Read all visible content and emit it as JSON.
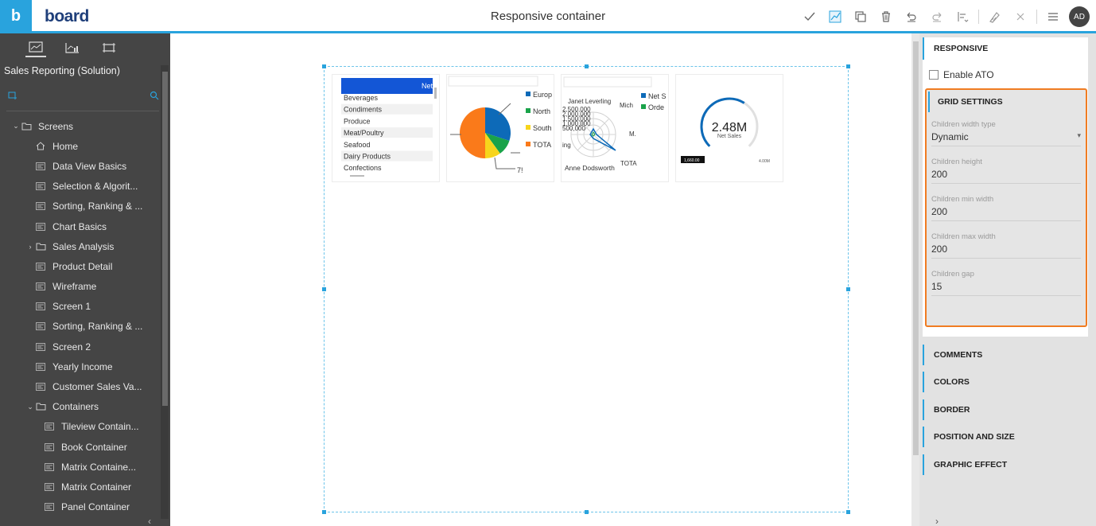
{
  "app": {
    "logo_letter": "b",
    "logo_word": "board"
  },
  "header": {
    "title": "Responsive container",
    "avatar_initials": "AD"
  },
  "colors": {
    "accent": "#29a3dd",
    "highlight": "#f07c22",
    "sidebar_bg": "#454545"
  },
  "sidebar": {
    "title": "Sales Reporting (Solution)",
    "items": [
      {
        "label": "Screens",
        "type": "folder",
        "chevron": "⌄",
        "indent": 0
      },
      {
        "label": "Home",
        "type": "home",
        "chevron": "",
        "indent": 1
      },
      {
        "label": "Data View Basics",
        "type": "screen",
        "chevron": "",
        "indent": 1
      },
      {
        "label": "Selection & Algorit...",
        "type": "screen",
        "chevron": "",
        "indent": 1
      },
      {
        "label": "Sorting, Ranking & ...",
        "type": "screen",
        "chevron": "",
        "indent": 1
      },
      {
        "label": "Chart Basics",
        "type": "screen",
        "chevron": "",
        "indent": 1
      },
      {
        "label": "Sales Analysis",
        "type": "folder",
        "chevron": "›",
        "indent": 1
      },
      {
        "label": "Product Detail",
        "type": "screen",
        "chevron": "",
        "indent": 1
      },
      {
        "label": "Wireframe",
        "type": "screen",
        "chevron": "",
        "indent": 1
      },
      {
        "label": "Screen 1",
        "type": "screen",
        "chevron": "",
        "indent": 1
      },
      {
        "label": "Sorting, Ranking & ...",
        "type": "screen",
        "chevron": "",
        "indent": 1
      },
      {
        "label": "Screen 2",
        "type": "screen",
        "chevron": "",
        "indent": 1
      },
      {
        "label": "Yearly Income",
        "type": "screen",
        "chevron": "",
        "indent": 1
      },
      {
        "label": "Customer Sales Va...",
        "type": "screen",
        "chevron": "",
        "indent": 1
      },
      {
        "label": "Containers",
        "type": "folder",
        "chevron": "⌄",
        "indent": 1
      },
      {
        "label": "Tileview Contain...",
        "type": "screen",
        "chevron": "",
        "indent": 2
      },
      {
        "label": "Book Container",
        "type": "screen",
        "chevron": "",
        "indent": 2
      },
      {
        "label": "Matrix Containe...",
        "type": "screen",
        "chevron": "",
        "indent": 2
      },
      {
        "label": "Matrix Container",
        "type": "screen",
        "chevron": "",
        "indent": 2
      },
      {
        "label": "Panel Container",
        "type": "screen",
        "chevron": "",
        "indent": 2
      }
    ]
  },
  "tiles": {
    "table": {
      "header": "Net",
      "rows": [
        "Beverages",
        "Condiments",
        "Produce",
        "Meat/Poultry",
        "Seafood",
        "Dairy Products",
        "Confections"
      ]
    },
    "pie": {
      "legend": [
        {
          "label": "Europ",
          "color": "#0d6ab8"
        },
        {
          "label": "North",
          "color": "#1aa34a"
        },
        {
          "label": "South",
          "color": "#f7d51c"
        },
        {
          "label": "TOTA",
          "color": "#fa7a1a"
        }
      ],
      "callout": "7!",
      "slices": [
        {
          "name": "Europ",
          "value": 0.3,
          "color": "#0d6ab8"
        },
        {
          "name": "North",
          "value": 0.1,
          "color": "#1aa34a"
        },
        {
          "name": "South",
          "value": 0.1,
          "color": "#f7d51c"
        },
        {
          "name": "TOTA",
          "value": 0.5,
          "color": "#fa7a1a"
        }
      ]
    },
    "radar": {
      "top_label": "Janet Leverling",
      "right_label": "Mich",
      "mid_right": "M.",
      "left_label": "ing",
      "bottom_label": "Anne Dodsworth",
      "bottom_right": "TOTA",
      "ticks": [
        "2,500,000",
        "2,000,000",
        "1,500,000",
        "1,000,000",
        "500,000"
      ],
      "legend": [
        {
          "label": "Net S",
          "color": "#0d6ab8"
        },
        {
          "label": "Orde",
          "color": "#1aa34a"
        }
      ]
    },
    "gauge": {
      "value": "2.48M",
      "label": "Net Sales",
      "min_badge": "1,660.00",
      "max": "4.00M",
      "fraction": 0.62
    }
  },
  "right_panel": {
    "responsive_title": "RESPONSIVE",
    "enable_ato": "Enable ATO",
    "grid_settings_title": "GRID SETTINGS",
    "fields": [
      {
        "label": "Children width type",
        "value": "Dynamic",
        "dropdown": true
      },
      {
        "label": "Children height",
        "value": "200",
        "dropdown": false
      },
      {
        "label": "Children min width",
        "value": "200",
        "dropdown": false
      },
      {
        "label": "Children max width",
        "value": "200",
        "dropdown": false
      },
      {
        "label": "Children gap",
        "value": "15",
        "dropdown": false
      }
    ],
    "sections": [
      "COMMENTS",
      "COLORS",
      "BORDER",
      "POSITION AND SIZE",
      "GRAPHIC EFFECT"
    ]
  }
}
